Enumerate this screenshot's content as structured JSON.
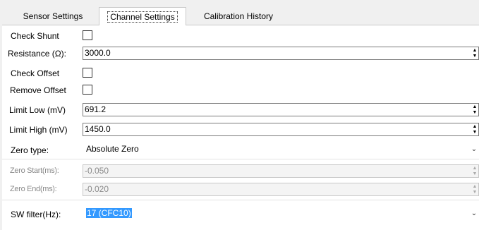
{
  "tabs": [
    {
      "label": "Sensor Settings",
      "active": false
    },
    {
      "label": "Channel Settings",
      "active": true
    },
    {
      "label": "Calibration History",
      "active": false
    }
  ],
  "form": {
    "check_shunt": {
      "label": "Check Shunt",
      "checked": false
    },
    "resistance": {
      "label": "Resistance (Ω):",
      "value": "3000.0"
    },
    "check_offset": {
      "label": "Check Offset",
      "checked": false
    },
    "remove_offset": {
      "label": "Remove Offset",
      "checked": false
    },
    "limit_low": {
      "label": "Limit Low (mV)",
      "value": "691.2"
    },
    "limit_high": {
      "label": "Limit High (mV)",
      "value": "1450.0"
    },
    "zero_type": {
      "label": "Zero type:",
      "value": "Absolute Zero"
    },
    "zero_start": {
      "label": "Zero Start(ms):",
      "value": "-0.050",
      "enabled": false
    },
    "zero_end": {
      "label": "Zero End(ms):",
      "value": "-0.020",
      "enabled": false
    },
    "sw_filter": {
      "label": "SW filter(Hz):",
      "value": "17 (CFC10)"
    }
  },
  "icons": {
    "spin": "up-down-arrows",
    "dropdown": "chevron-down"
  },
  "colors": {
    "selection": "#3399ff",
    "panel_bg": "#ffffff",
    "window_bg": "#f0f0f0"
  }
}
